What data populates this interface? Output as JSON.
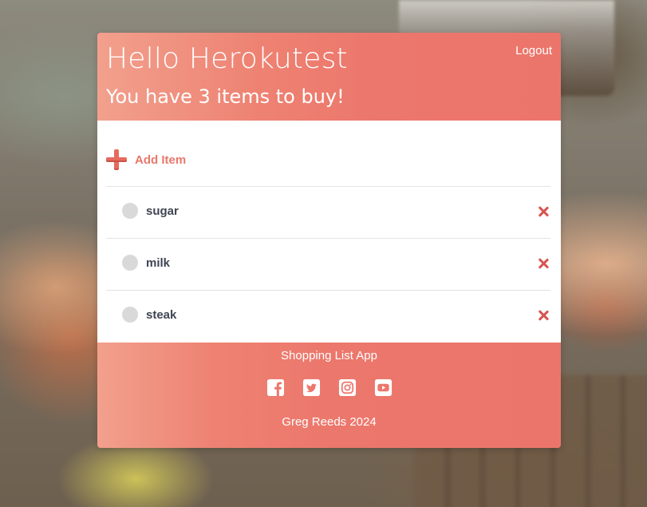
{
  "header": {
    "greeting": "Hello Herokutest",
    "count_line": "You have 3 items to buy!",
    "logout_label": "Logout"
  },
  "actions": {
    "add_item_label": "Add Item"
  },
  "items": [
    {
      "name": "sugar",
      "checked": false
    },
    {
      "name": "milk",
      "checked": false
    },
    {
      "name": "steak",
      "checked": false
    }
  ],
  "footer": {
    "title": "Shopping List App",
    "credit": "Greg Reeds 2024",
    "social_icons": [
      "facebook-icon",
      "twitter-icon",
      "instagram-icon",
      "youtube-icon"
    ]
  },
  "colors": {
    "accent": "#ec776c",
    "accent_light": "#f2a08d",
    "delete": "#d9534f",
    "item_text": "#3e4552",
    "check_circle": "#d9d9d9"
  }
}
